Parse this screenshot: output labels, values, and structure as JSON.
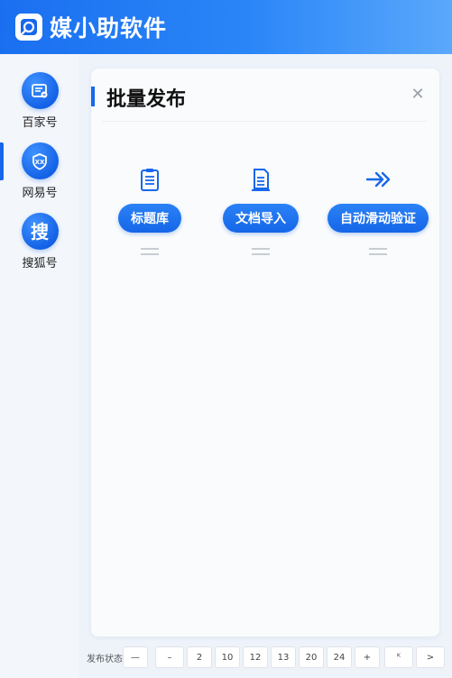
{
  "app": {
    "title": "媒小助软件",
    "logo_icon": "app-logo-icon",
    "accent": "#1767ec"
  },
  "sidebar": {
    "items": [
      {
        "label": "百家号",
        "icon": "baijiahao-icon",
        "active": false
      },
      {
        "label": "网易号",
        "icon": "wangyihao-icon",
        "active": true
      },
      {
        "label": "搜狐号",
        "icon": "sohu-icon",
        "glyph": "搜",
        "active": false
      }
    ]
  },
  "panel": {
    "title": "批量发布",
    "actions": [
      {
        "label": "标题库",
        "icon": "clipboard-list-icon"
      },
      {
        "label": "文档导入",
        "icon": "document-import-icon"
      },
      {
        "label": "自动滑动验证",
        "icon": "double-arrow-right-icon"
      }
    ]
  },
  "footer": {
    "label": "发布状态",
    "pages": [
      "—",
      "–",
      "2",
      "10",
      "12",
      "13",
      "20",
      "24",
      "+"
    ],
    "nav": [
      "ᴷ",
      ">"
    ]
  }
}
